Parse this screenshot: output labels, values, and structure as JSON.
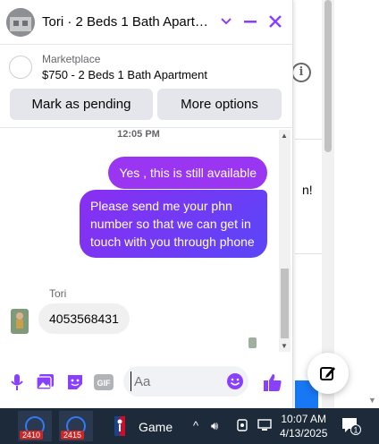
{
  "chat": {
    "header": {
      "title": "Tori · 2 Beds 1 Bath Apart…"
    },
    "listing": {
      "source": "Marketplace",
      "title": "$750 - 2 Beds 1 Bath Apartment"
    },
    "actions": {
      "mark_pending": "Mark as pending",
      "more_options": "More options"
    },
    "timestamp": "12:05 PM",
    "messages": [
      {
        "from": "me",
        "text": "Yes , this is still available"
      },
      {
        "from": "me",
        "text": "Please send me your phn number so that we can get in touch with you through phone"
      },
      {
        "from": "Tori",
        "text": "4053568431"
      }
    ],
    "sender_name": "Tori",
    "composer": {
      "placeholder": "Aa",
      "gif_label": "GIF"
    }
  },
  "background": {
    "partial_text": "n!"
  },
  "taskbar": {
    "app_badge_1": "2410",
    "app_badge_2": "2415",
    "game_label": "Game",
    "time": "10:07 AM",
    "date": "4/13/2025",
    "notification_count": "1"
  },
  "colors": {
    "accent_purple": "#8a3ffc",
    "bubble_out_start": "#9a36f2",
    "bubble_out_end": "#5a46f7",
    "thumb_blue": "#1877f2"
  }
}
